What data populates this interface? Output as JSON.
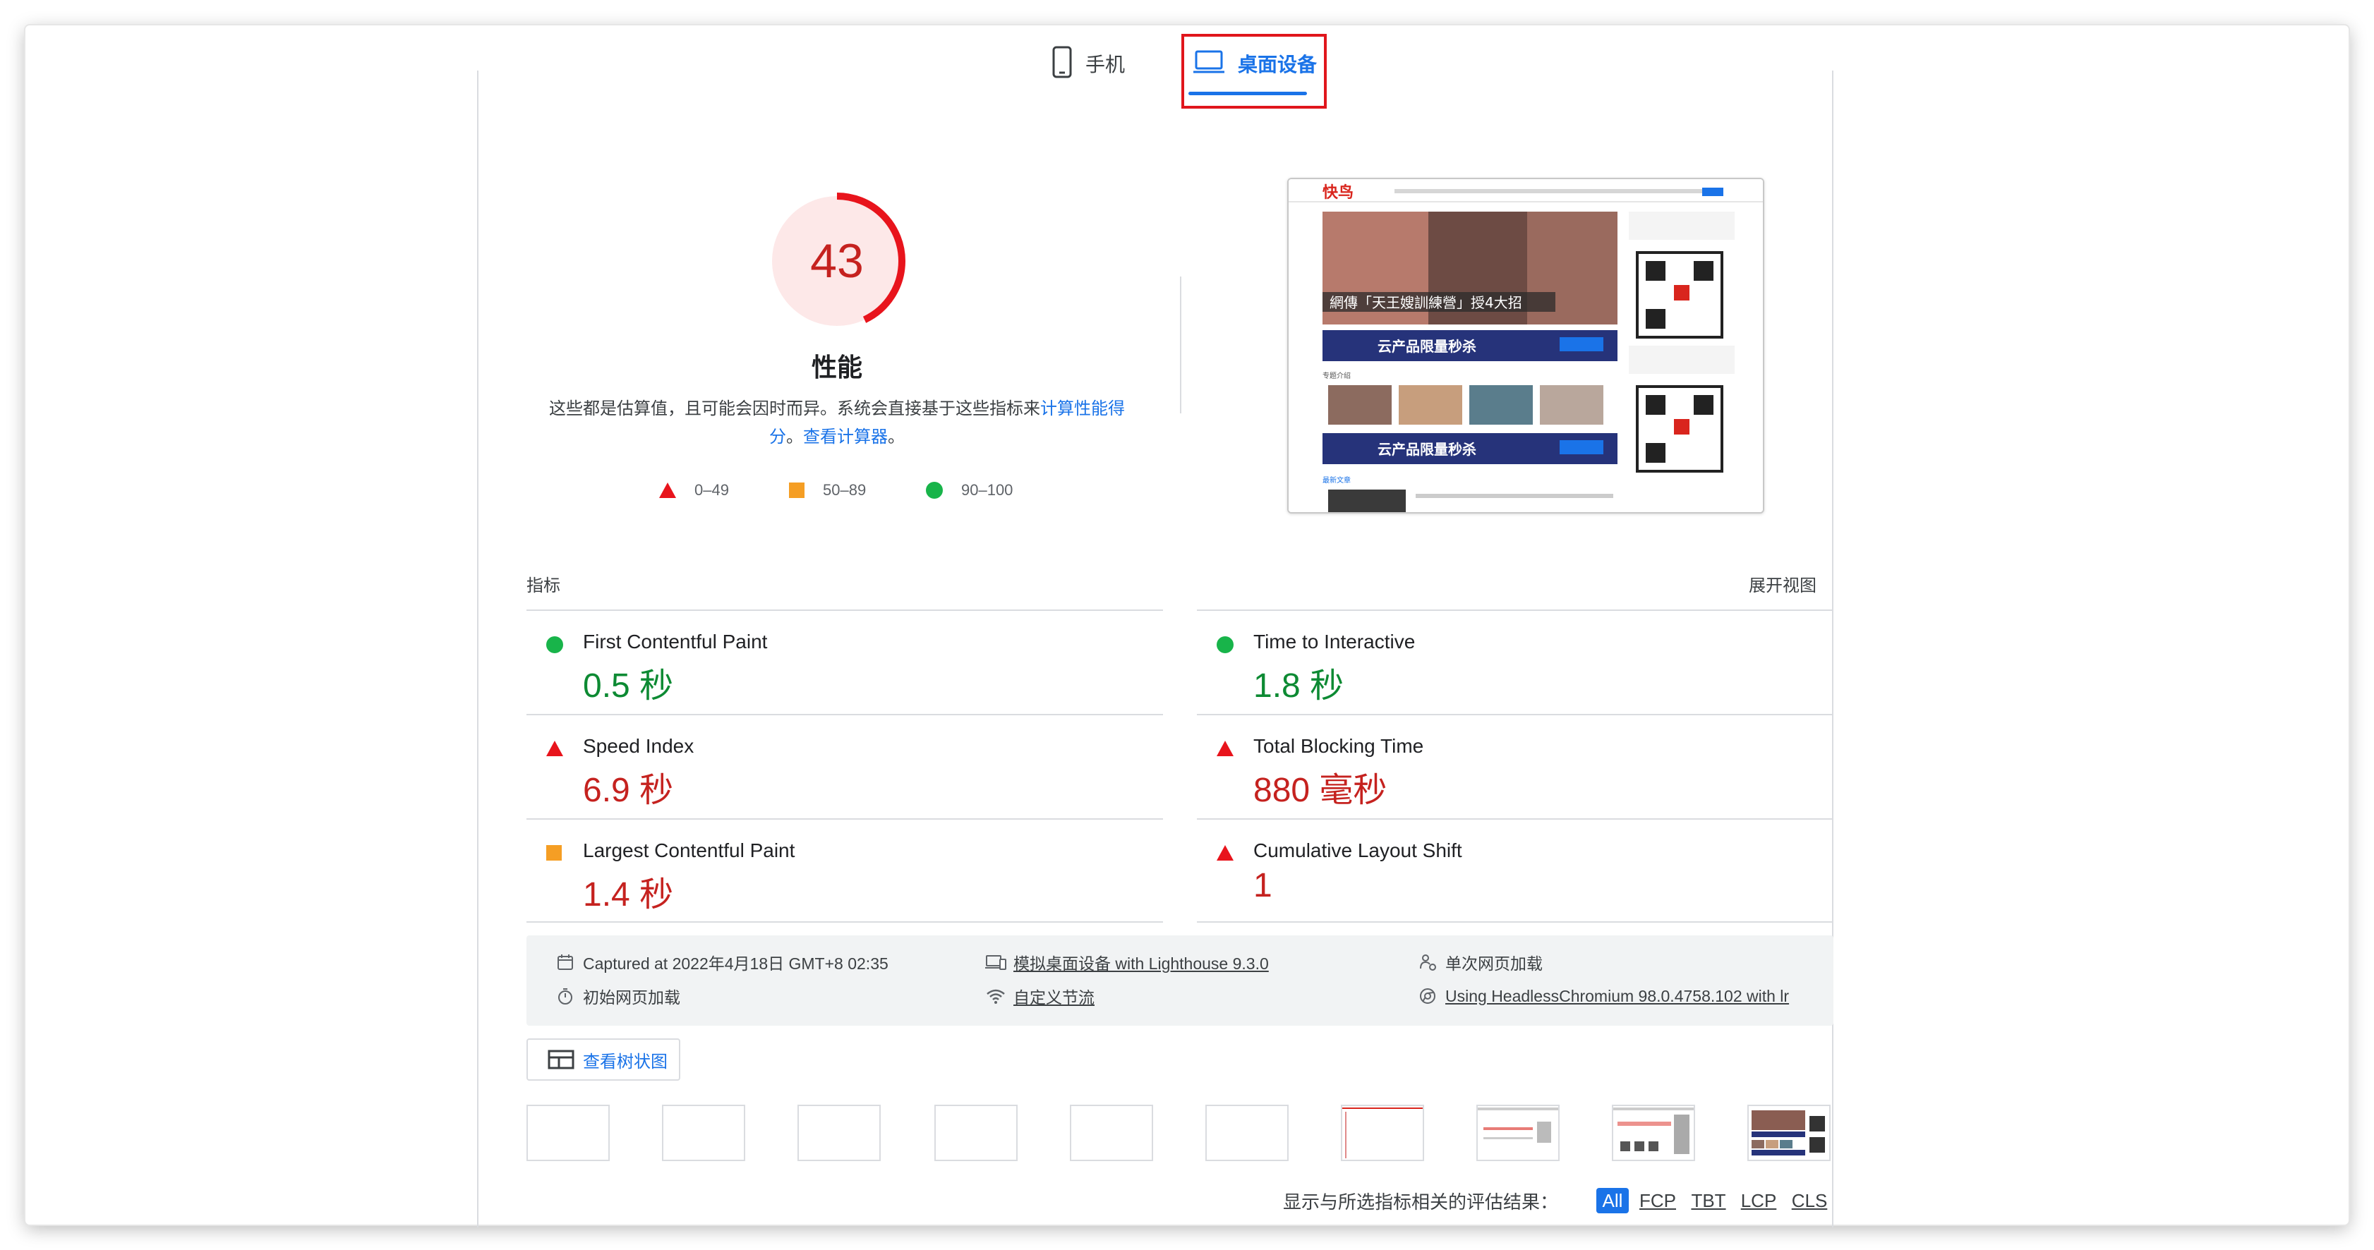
{
  "tabs": {
    "mobile": "手机",
    "desktop": "桌面设备"
  },
  "gauge": {
    "score": "43",
    "score_fraction": 0.43,
    "title": "性能",
    "description_prefix": "这些都是估算值，且可能会因时而异。系统会直接基于这些指标来",
    "description_link1": "计算性能得分",
    "description_mid": "。",
    "description_link2": "查看计算器",
    "description_suffix": "。"
  },
  "legend": {
    "fail": "0–49",
    "average": "50–89",
    "pass": "90–100"
  },
  "colors": {
    "fail": "#e8141c",
    "average": "#f59e24",
    "pass": "#18b44a",
    "accent": "#1a73e8"
  },
  "metrics": {
    "title": "指标",
    "toggle_label": "展开视图",
    "items": [
      {
        "name": "First Contentful Paint",
        "value": "0.5 秒",
        "rating": "pass"
      },
      {
        "name": "Time to Interactive",
        "value": "1.8 秒",
        "rating": "pass"
      },
      {
        "name": "Speed Index",
        "value": "6.9 秒",
        "rating": "fail"
      },
      {
        "name": "Total Blocking Time",
        "value": "880 毫秒",
        "rating": "fail"
      },
      {
        "name": "Largest Contentful Paint",
        "value": "1.4 秒",
        "rating": "average"
      },
      {
        "name": "Cumulative Layout Shift",
        "value": "1",
        "rating": "fail"
      }
    ]
  },
  "runtime": {
    "captured": "Captured at 2022年4月18日 GMT+8 02:35",
    "initial_load": "初始网页加载",
    "emulation": "模拟桌面设备 with Lighthouse 9.3.0",
    "throttling": "自定义节流",
    "single_load": "单次网页加载",
    "browser": "Using HeadlessChromium 98.0.4758.102 with lr"
  },
  "treemap_button": "查看树状图",
  "filter": {
    "label": "显示与所选指标相关的评估结果：",
    "options": [
      "All",
      "FCP",
      "TBT",
      "LCP",
      "CLS"
    ],
    "active": "All"
  },
  "thumbnail": {
    "logo_text": "快鸟",
    "banner_text": "網傳「天王嫂訓練營」授4大招",
    "ad_text": "云产品限量秒杀",
    "section_label": "专题介绍",
    "bottom_text": "最新文章"
  }
}
